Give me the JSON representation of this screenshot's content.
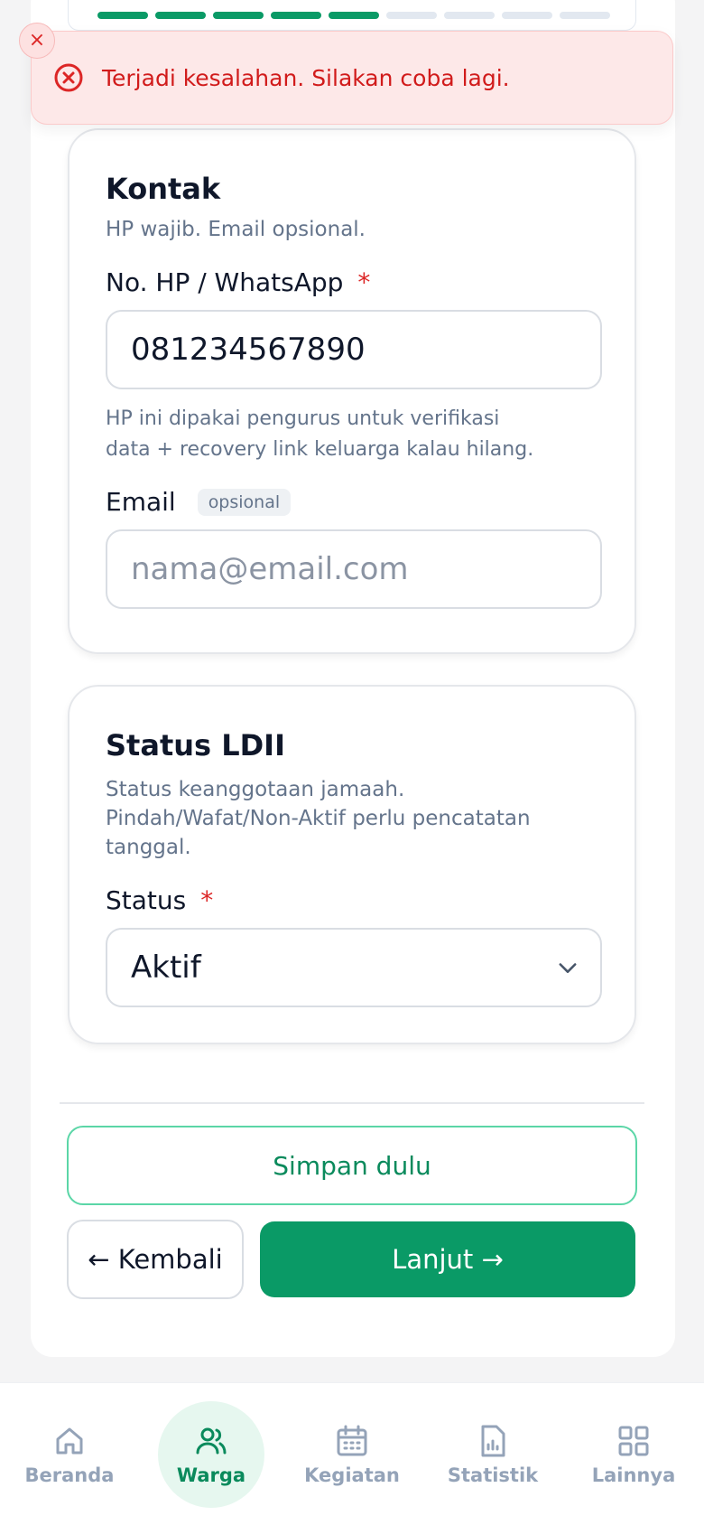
{
  "progress": {
    "total_steps": 9,
    "completed_steps": 5
  },
  "toast": {
    "message": "Terjadi kesalahan. Silakan coba lagi.",
    "close_icon": "×"
  },
  "contact": {
    "title": "Kontak",
    "subtitle": "HP wajib. Email opsional.",
    "phone": {
      "label": "No. HP / WhatsApp",
      "required_mark": "*",
      "value": "081234567890",
      "help": "HP ini dipakai pengurus untuk verifikasi data + recovery link keluarga kalau hilang."
    },
    "email": {
      "label": "Email",
      "badge": "opsional",
      "placeholder": "nama@email.com",
      "value": ""
    }
  },
  "status_section": {
    "title": "Status LDII",
    "subtitle": "Status keanggotaan jamaah. Pindah/Wafat/Non-Aktif perlu pencatatan tanggal.",
    "status": {
      "label": "Status",
      "required_mark": "*",
      "selected": "Aktif"
    }
  },
  "actions": {
    "save_draft": "Simpan dulu",
    "back": "← Kembali",
    "next": "Lanjut →"
  },
  "nav": {
    "items": [
      {
        "label": "Beranda",
        "icon": "home-icon",
        "active": false
      },
      {
        "label": "Warga",
        "icon": "users-icon",
        "active": true
      },
      {
        "label": "Kegiatan",
        "icon": "calendar-icon",
        "active": false
      },
      {
        "label": "Statistik",
        "icon": "chart-file-icon",
        "active": false
      },
      {
        "label": "Lainnya",
        "icon": "grid-icon",
        "active": false
      }
    ]
  },
  "colors": {
    "primary": "#0a9a66",
    "error_bg": "#fde8e8",
    "error_text": "#d11b1b",
    "muted": "#64748b"
  }
}
